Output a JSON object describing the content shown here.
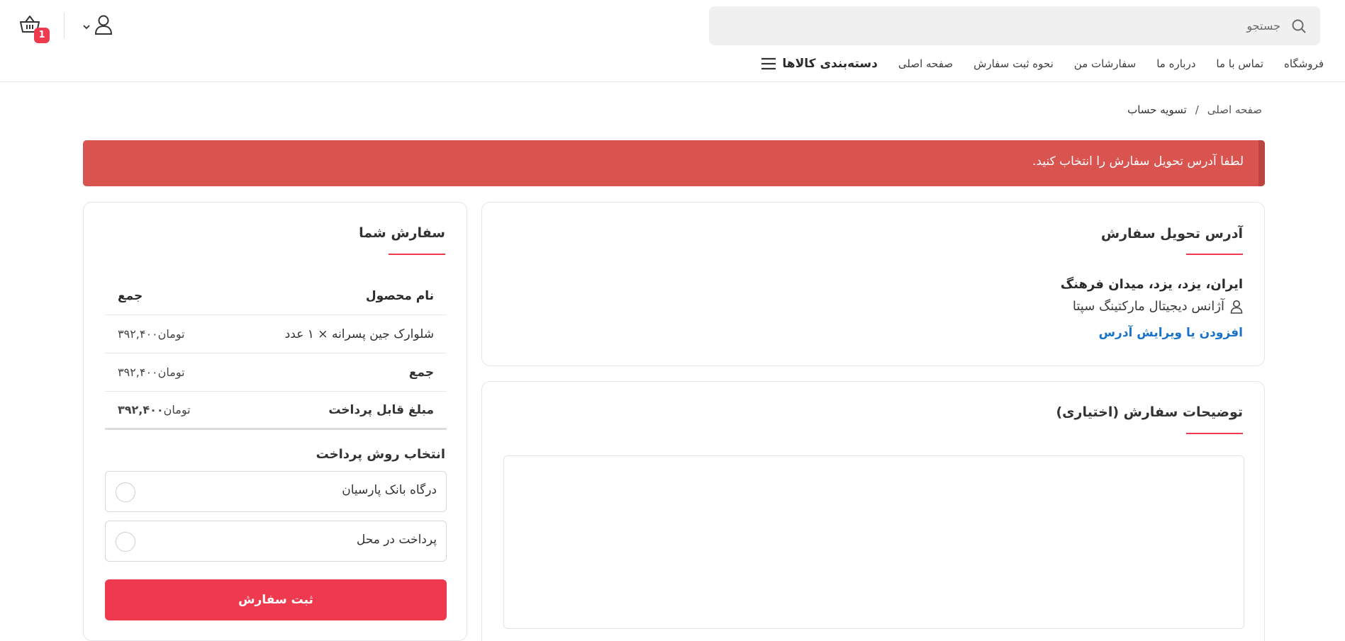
{
  "header": {
    "search_placeholder": "جستجو",
    "cart_count": "1",
    "icons": {
      "search": "search-icon",
      "cart": "basket-icon",
      "user": "user-icon",
      "chevron": "chevron-down-icon",
      "menu": "menu-icon"
    }
  },
  "nav": {
    "categories_label": "دسته‌بندی کالاها",
    "links": [
      "صفحه اصلی",
      "نحوه ثبت سفارش",
      "سفارشات من",
      "درباره ما",
      "تماس با ما",
      "فروشگاه"
    ]
  },
  "breadcrumb": {
    "home": "صفحه اصلی",
    "separator": "/",
    "current": "تسویه حساب"
  },
  "alert": {
    "text": "لطفا آدرس تحویل سفارش را انتخاب کنید."
  },
  "address": {
    "title": "آدرس تحویل سفارش",
    "line1": "ایران، یزد، یزد، میدان فرهنگ",
    "recipient": "آژانس دیجیتال مارکتینگ سپتا",
    "edit_link": "افزودن یا ویرایش آدرس"
  },
  "notes": {
    "title": "توضیحات سفارش (اختیاری)",
    "value": ""
  },
  "order": {
    "title": "سفارش شما",
    "col_product": "نام محصول",
    "col_total": "جمع",
    "rows": [
      {
        "name": "شلوارک جین پسرانه × ۱ عدد",
        "amount": "۳۹۲,۴۰۰",
        "currency": "تومان"
      },
      {
        "name": "جمع",
        "amount": "۳۹۲,۴۰۰",
        "currency": "تومان"
      },
      {
        "name": "مبلغ قابل پرداخت",
        "amount": "۳۹۲,۴۰۰",
        "currency": "تومان"
      }
    ],
    "payment_title": "انتخاب روش پرداخت",
    "payment_options": [
      "درگاه بانک پارسیان",
      "پرداخت در محل"
    ],
    "submit_label": "ثبت سفارش"
  },
  "colors": {
    "accent": "#ef394e",
    "alert_bg": "#d9534f",
    "link": "#1a73c9"
  }
}
